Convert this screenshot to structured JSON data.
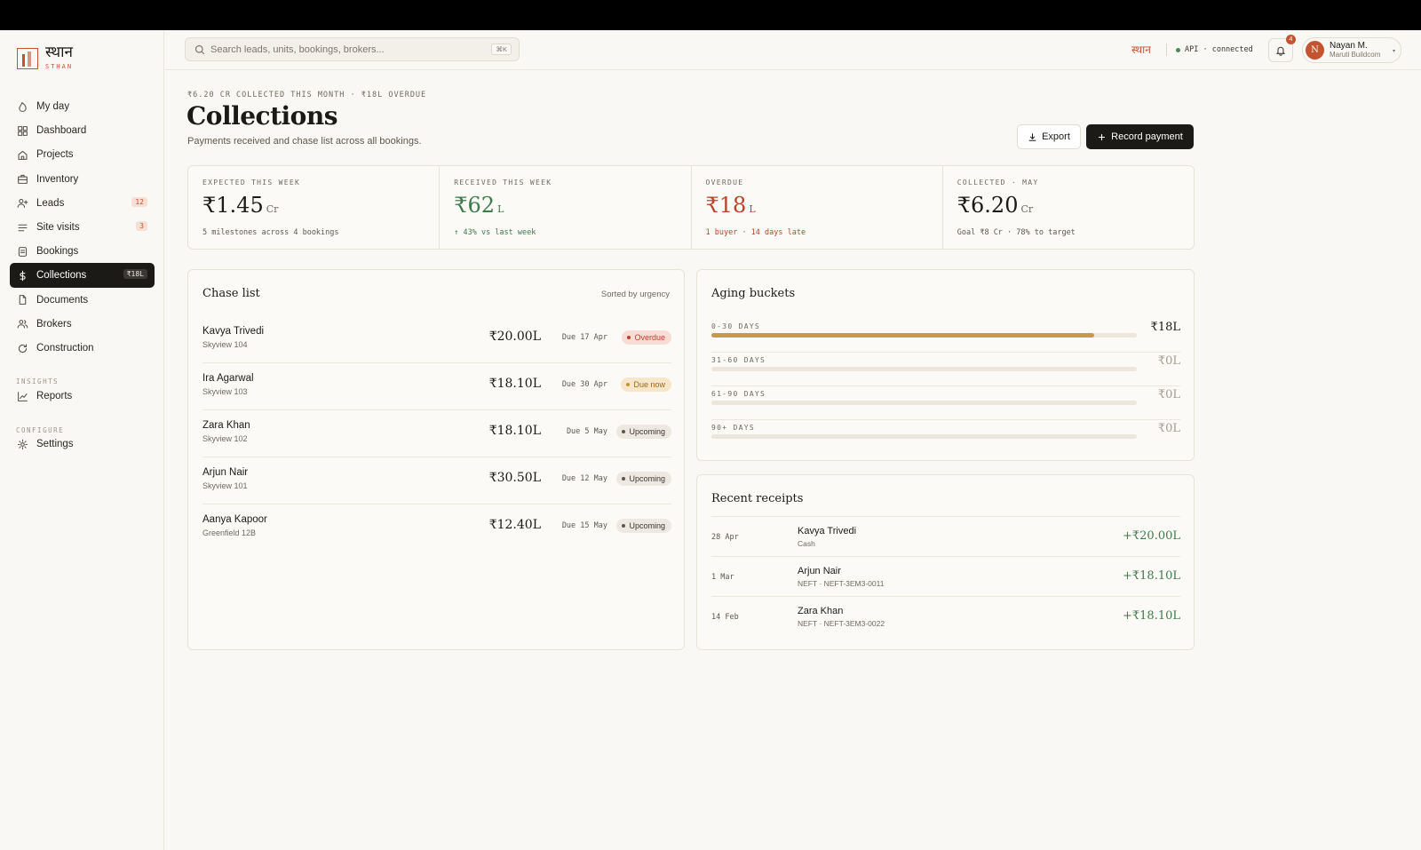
{
  "brand": {
    "name": "स्थान",
    "sub": "STHAN"
  },
  "nav": [
    {
      "label": "My day",
      "icon": "flame-icon"
    },
    {
      "label": "Dashboard",
      "icon": "grid-icon"
    },
    {
      "label": "Projects",
      "icon": "home-icon"
    },
    {
      "label": "Inventory",
      "icon": "briefcase-icon"
    },
    {
      "label": "Leads",
      "icon": "user-plus-icon",
      "badge": "12"
    },
    {
      "label": "Site visits",
      "icon": "list-icon",
      "badge": "3"
    },
    {
      "label": "Bookings",
      "icon": "receipt-icon"
    },
    {
      "label": "Collections",
      "icon": "dollar-icon",
      "badge": "₹18L",
      "active": true
    },
    {
      "label": "Documents",
      "icon": "file-icon"
    },
    {
      "label": "Brokers",
      "icon": "users-icon"
    },
    {
      "label": "Construction",
      "icon": "refresh-icon"
    }
  ],
  "sections": {
    "insights": "INSIGHTS",
    "configure": "CONFIGURE"
  },
  "nav_insights": [
    {
      "label": "Reports",
      "icon": "chart-icon"
    }
  ],
  "nav_configure": [
    {
      "label": "Settings",
      "icon": "gear-icon"
    }
  ],
  "topbar": {
    "search_placeholder": "Search leads, units, bookings, brokers...",
    "shortcut": "⌘K",
    "brand": "स्थान",
    "api_status": "API · connected",
    "notifications": "4",
    "user_initial": "N",
    "user_name": "Nayan M.",
    "user_org": "Maruti Buildcom"
  },
  "page": {
    "crumb": "₹6.20 CR COLLECTED THIS MONTH · ₹18L OVERDUE",
    "title": "Collections",
    "subtitle": "Payments received and chase list across all bookings.",
    "export_label": "Export",
    "record_label": "Record payment"
  },
  "stats": [
    {
      "label": "EXPECTED THIS WEEK",
      "value": "₹1.45",
      "unit": "Cr",
      "note": "5 milestones across 4 bookings",
      "tone": ""
    },
    {
      "label": "RECEIVED THIS WEEK",
      "value": "₹62",
      "unit": "L",
      "note": "↑ 43% vs last week",
      "tone": "green"
    },
    {
      "label": "OVERDUE",
      "value": "₹18",
      "unit": "L",
      "note": "1 buyer · 14 days late",
      "tone": "red"
    },
    {
      "label": "COLLECTED · MAY",
      "value": "₹6.20",
      "unit": "Cr",
      "note": "Goal ₹8 Cr · 78% to target",
      "tone": ""
    }
  ],
  "chase": {
    "title": "Chase list",
    "sort": "Sorted by urgency",
    "rows": [
      {
        "name": "Kavya Trivedi",
        "unit": "Skyview 104",
        "amount": "₹20.00L",
        "due": "Due 17 Apr",
        "status": "Overdue",
        "kind": "overdue"
      },
      {
        "name": "Ira Agarwal",
        "unit": "Skyview 103",
        "amount": "₹18.10L",
        "due": "Due 30 Apr",
        "status": "Due now",
        "kind": "duenow"
      },
      {
        "name": "Zara Khan",
        "unit": "Skyview 102",
        "amount": "₹18.10L",
        "due": "Due 5 May",
        "status": "Upcoming",
        "kind": "upcoming"
      },
      {
        "name": "Arjun Nair",
        "unit": "Skyview 101",
        "amount": "₹30.50L",
        "due": "Due 12 May",
        "status": "Upcoming",
        "kind": "upcoming"
      },
      {
        "name": "Aanya Kapoor",
        "unit": "Greenfield 12B",
        "amount": "₹12.40L",
        "due": "Due 15 May",
        "status": "Upcoming",
        "kind": "upcoming"
      }
    ]
  },
  "aging": {
    "title": "Aging buckets",
    "buckets": [
      {
        "label": "0-30 DAYS",
        "value": "₹18L",
        "fill": 0.9
      },
      {
        "label": "31-60 DAYS",
        "value": "₹0L",
        "fill": 0
      },
      {
        "label": "61-90 DAYS",
        "value": "₹0L",
        "fill": 0
      },
      {
        "label": "90+ DAYS",
        "value": "₹0L",
        "fill": 0
      }
    ]
  },
  "receipts": {
    "title": "Recent receipts",
    "rows": [
      {
        "date": "28 Apr",
        "name": "Kavya Trivedi",
        "meta": "Cash",
        "amount": "+₹20.00L"
      },
      {
        "date": "1 Mar",
        "name": "Arjun Nair",
        "meta": "NEFT · NEFT-3EM3-0011",
        "amount": "+₹18.10L"
      },
      {
        "date": "14 Feb",
        "name": "Zara Khan",
        "meta": "NEFT · NEFT-3EM3-0022",
        "amount": "+₹18.10L"
      }
    ]
  }
}
